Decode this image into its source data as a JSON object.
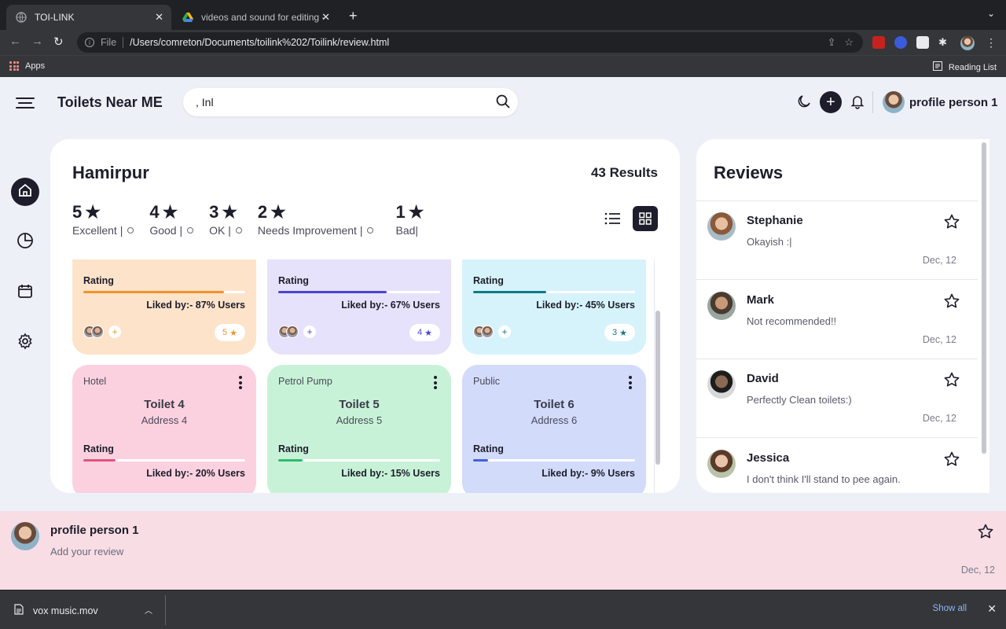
{
  "browser": {
    "tabs": [
      {
        "title": "TOI-LINK",
        "active": true
      },
      {
        "title": "videos and sound for editing -",
        "active": false
      }
    ],
    "url_scheme": "File",
    "url": "/Users/comreton/Documents/toilink%202/Toilink/review.html",
    "bookmarks": {
      "apps_label": "Apps",
      "reading_list_label": "Reading List"
    }
  },
  "header": {
    "brand": "Toilets Near ME",
    "search_value": ", Inl",
    "profile_name": "profile person 1"
  },
  "main": {
    "city": "Hamirpur",
    "results": "43 Results",
    "rating_filters": [
      {
        "stars": "5",
        "label": "Excellent |"
      },
      {
        "stars": "4",
        "label": "Good |"
      },
      {
        "stars": "3",
        "label": "OK |"
      },
      {
        "stars": "2",
        "label": "Needs Improvement |"
      },
      {
        "stars": "1",
        "label": "Bad|"
      }
    ],
    "cards": [
      {
        "type": "",
        "title": "",
        "address": "",
        "rating_label": "Rating",
        "liked": "Liked by:- 87% Users",
        "percent": 87,
        "stars": "5",
        "bg": "#fde3c9",
        "accent": "#f0932b",
        "star_color": "#f0932b"
      },
      {
        "type": "",
        "title": "",
        "address": "",
        "rating_label": "Rating",
        "liked": "Liked by:- 67% Users",
        "percent": 67,
        "stars": "4",
        "bg": "#e6e2fb",
        "accent": "#4b45d6",
        "star_color": "#4b45d6"
      },
      {
        "type": "",
        "title": "",
        "address": "",
        "rating_label": "Rating",
        "liked": "Liked by:- 45% Users",
        "percent": 45,
        "stars": "3",
        "bg": "#d6f3fb",
        "accent": "#137a86",
        "star_color": "#137a86"
      },
      {
        "type": "Hotel",
        "title": "Toilet 4",
        "address": "Address 4",
        "rating_label": "Rating",
        "liked": "Liked by:- 20% Users",
        "percent": 20,
        "bg": "#fcd1df",
        "accent": "#e0557f"
      },
      {
        "type": "Petrol Pump",
        "title": "Toilet 5",
        "address": "Address 5",
        "rating_label": "Rating",
        "liked": "Liked by:- 15% Users",
        "percent": 15,
        "bg": "#c8f2d8",
        "accent": "#2ebd6a"
      },
      {
        "type": "Public",
        "title": "Toilet 6",
        "address": "Address 6",
        "rating_label": "Rating",
        "liked": "Liked by:- 9% Users",
        "percent": 9,
        "bg": "#d3dbfb",
        "accent": "#3e63dd"
      }
    ]
  },
  "reviews": {
    "title": "Reviews",
    "items": [
      {
        "name": "Stephanie",
        "text": "Okayish :|",
        "date": "Dec, 12"
      },
      {
        "name": "Mark",
        "text": "Not recommended!!",
        "date": "Dec, 12"
      },
      {
        "name": "David",
        "text": "Perfectly Clean toilets:)",
        "date": "Dec, 12"
      },
      {
        "name": "Jessica",
        "text": "I don't think I'll stand to pee again.",
        "date": "Dec, 12"
      }
    ]
  },
  "my_review": {
    "name": "profile person 1",
    "placeholder": "Add your review",
    "date": "Dec, 12"
  },
  "downloads": {
    "file": "vox music.mov",
    "show_all": "Show all"
  }
}
